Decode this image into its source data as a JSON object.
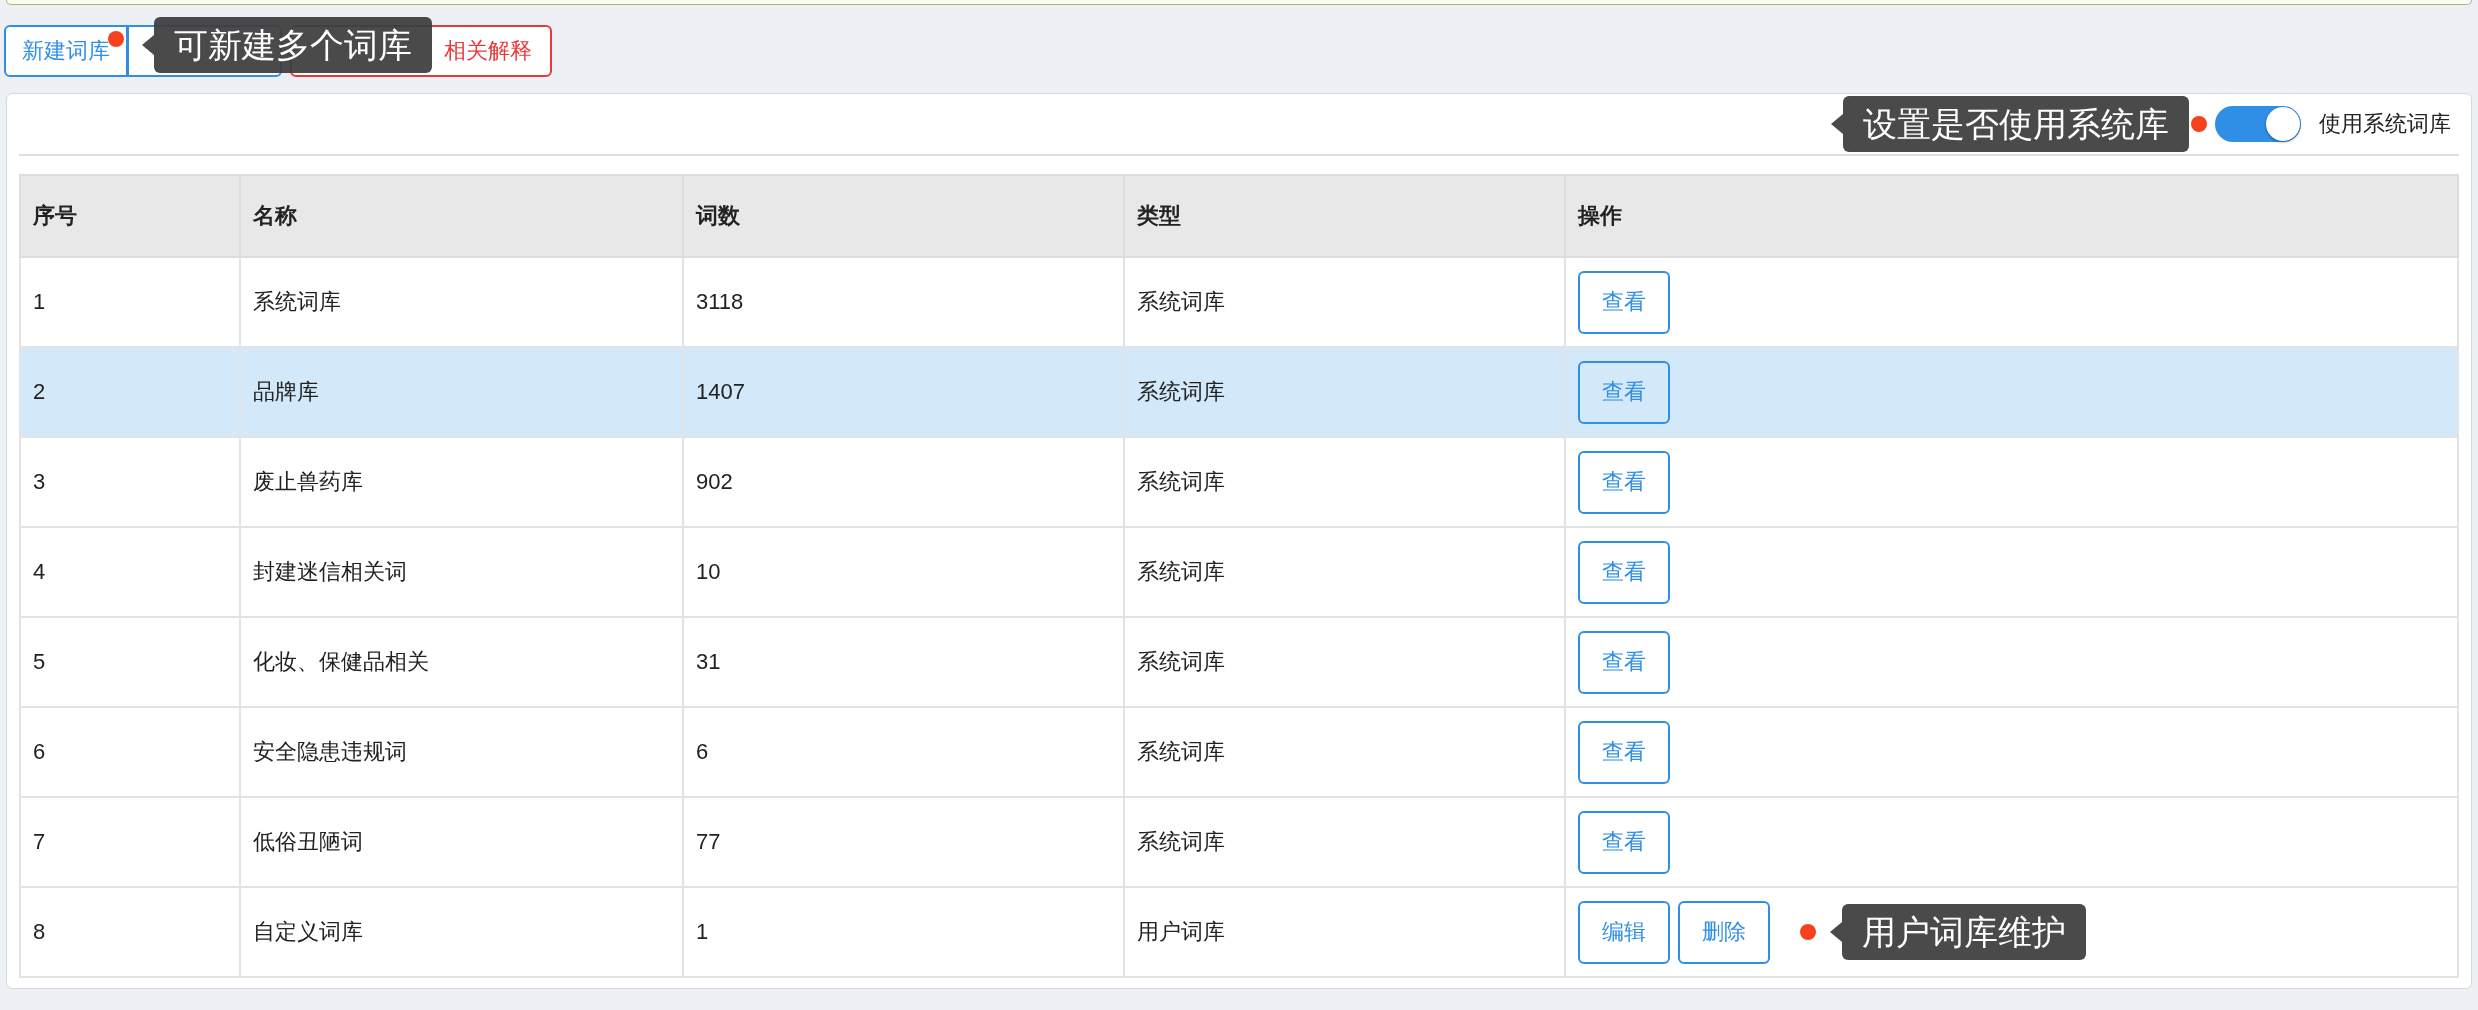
{
  "toolbar": {
    "buttons": [
      {
        "label": "新建词库",
        "kind": "primary",
        "dot": true
      },
      {
        "kind": "primary",
        "dot": false
      },
      {
        "label": "相关解释",
        "kind": "danger",
        "dot": false
      }
    ],
    "callout": {
      "text": "可新建多个词库"
    }
  },
  "settings": {
    "callout": {
      "text": "设置是否使用系统库"
    },
    "toggle": {
      "on": true,
      "label": "使用系统词库"
    }
  },
  "table": {
    "columns": [
      "序号",
      "名称",
      "词数",
      "类型",
      "操作"
    ],
    "rows": [
      {
        "cells": [
          "1",
          "系统词库",
          "3118",
          "系统词库"
        ],
        "actions": [
          "查看"
        ],
        "selected": false
      },
      {
        "cells": [
          "2",
          "品牌库",
          "1407",
          "系统词库"
        ],
        "actions": [
          "查看"
        ],
        "selected": true
      },
      {
        "cells": [
          "3",
          "废止兽药库",
          "902",
          "系统词库"
        ],
        "actions": [
          "查看"
        ],
        "selected": false
      },
      {
        "cells": [
          "4",
          "封建迷信相关词",
          "10",
          "系统词库"
        ],
        "actions": [
          "查看"
        ],
        "selected": false
      },
      {
        "cells": [
          "5",
          "化妆、保健品相关",
          "31",
          "系统词库"
        ],
        "actions": [
          "查看"
        ],
        "selected": false
      },
      {
        "cells": [
          "6",
          "安全隐患违规词",
          "6",
          "系统词库"
        ],
        "actions": [
          "查看"
        ],
        "selected": false
      },
      {
        "cells": [
          "7",
          "低俗丑陋词",
          "77",
          "系统词库"
        ],
        "actions": [
          "查看"
        ],
        "selected": false
      },
      {
        "cells": [
          "8",
          "自定义词库",
          "1",
          "用户词库"
        ],
        "actions": [
          "编辑",
          "删除"
        ],
        "selected": false
      }
    ],
    "callout": {
      "text": "用户词库维护"
    }
  }
}
